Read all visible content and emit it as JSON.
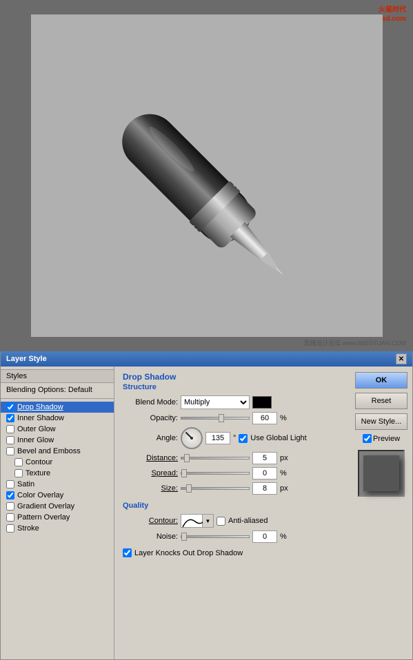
{
  "app": {
    "title": "Layer Style",
    "watermark_line1": "火星时代",
    "watermark_line2": "www.hxsd.com",
    "bottom_watermark": "思绪设计论坛  www.MISSYUAN.COM"
  },
  "styles_panel": {
    "header_label": "Styles",
    "blending_label": "Blending Options: Default",
    "items": [
      {
        "id": "drop-shadow",
        "label": "Drop Shadow",
        "checked": true,
        "active": true,
        "indented": false
      },
      {
        "id": "inner-shadow",
        "label": "Inner Shadow",
        "checked": true,
        "indented": false
      },
      {
        "id": "outer-glow",
        "label": "Outer Glow",
        "checked": false,
        "indented": false
      },
      {
        "id": "inner-glow",
        "label": "Inner Glow",
        "checked": false,
        "indented": false
      },
      {
        "id": "bevel-emboss",
        "label": "Bevel and Emboss",
        "checked": false,
        "indented": false
      },
      {
        "id": "contour",
        "label": "Contour",
        "checked": false,
        "indented": true
      },
      {
        "id": "texture",
        "label": "Texture",
        "checked": false,
        "indented": true
      },
      {
        "id": "satin",
        "label": "Satin",
        "checked": false,
        "indented": false
      },
      {
        "id": "color-overlay",
        "label": "Color Overlay",
        "checked": true,
        "indented": false
      },
      {
        "id": "gradient-overlay",
        "label": "Gradient Overlay",
        "checked": false,
        "indented": false
      },
      {
        "id": "pattern-overlay",
        "label": "Pattern Overlay",
        "checked": false,
        "indented": false
      },
      {
        "id": "stroke",
        "label": "Stroke",
        "checked": false,
        "indented": false
      }
    ]
  },
  "drop_shadow": {
    "section_title": "Drop Shadow",
    "sub_title": "Structure",
    "blend_mode_label": "Blend Mode:",
    "blend_mode_value": "Multiply",
    "opacity_label": "Opacity:",
    "opacity_value": "60",
    "opacity_unit": "%",
    "angle_label": "Angle:",
    "angle_value": "135",
    "angle_unit": "°",
    "global_light_label": "Use Global Light",
    "distance_label": "Distance:",
    "distance_value": "5",
    "distance_unit": "px",
    "spread_label": "Spread:",
    "spread_value": "0",
    "spread_unit": "%",
    "size_label": "Size:",
    "size_value": "8",
    "size_unit": "px",
    "quality_title": "Quality",
    "contour_label": "Contour:",
    "anti_alias_label": "Anti-aliased",
    "noise_label": "Noise:",
    "noise_value": "0",
    "noise_unit": "%",
    "knockout_label": "Layer Knocks Out Drop Shadow"
  },
  "buttons": {
    "ok": "OK",
    "reset": "Reset",
    "new_style": "New Style...",
    "preview_checked": true,
    "preview_label": "Preview"
  }
}
